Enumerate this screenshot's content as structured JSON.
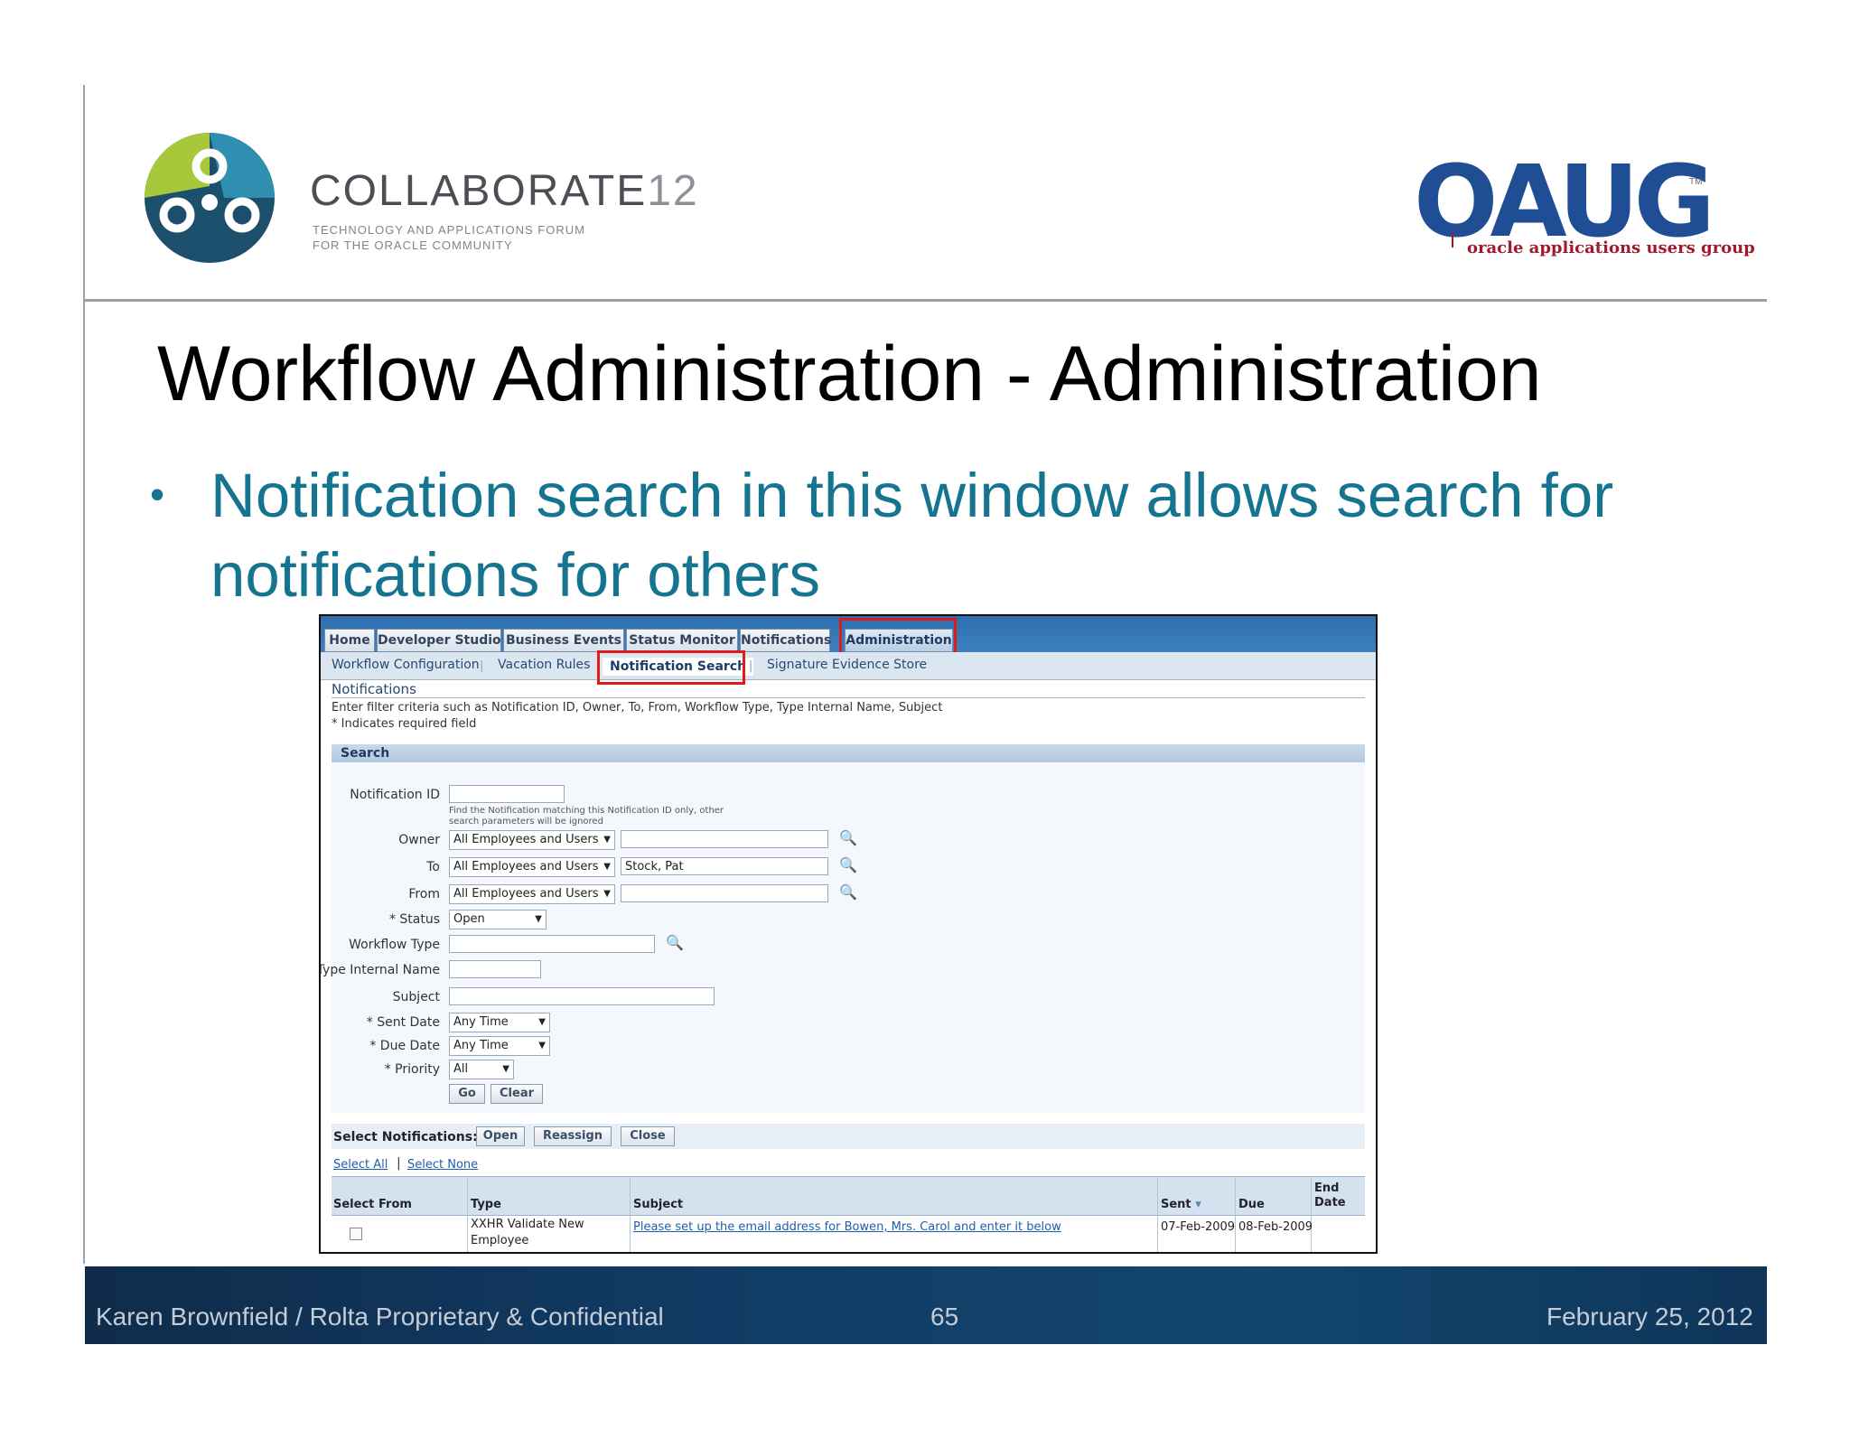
{
  "header": {
    "collab_name": "COLLABORATE",
    "collab_num": "12",
    "collab_sub1": "TECHNOLOGY AND APPLICATIONS FORUM",
    "collab_sub2": "FOR THE ORACLE COMMUNITY",
    "oaug_logo_text": "OAUG",
    "oaug_tm": "TM",
    "oaug_sub": "oracle applications users group"
  },
  "slide": {
    "title": "Workflow Administration - Administration",
    "bullet": "Notification search in this window allows search for notifications for others"
  },
  "footer": {
    "left": "Karen Brownfield  /  Rolta  Proprietary & Confidential",
    "page": "65",
    "date": "February 25, 2012"
  },
  "app": {
    "tabs": [
      "Home",
      "Developer Studio",
      "Business Events",
      "Status Monitor",
      "Notifications",
      "Administration"
    ],
    "subtabs": [
      "Workflow Configuration",
      "Vacation Rules",
      "Notification Search",
      "Signature Evidence Store"
    ],
    "section_title": "Notifications",
    "instructions": "Enter filter criteria such as Notification ID, Owner, To, From, Workflow Type, Type Internal Name, Subject",
    "required_note": "* Indicates required field",
    "search_header": "Search",
    "fields": {
      "notification_id": "Notification ID",
      "notification_hint": "Find the Notification matching this Notification ID only, other search parameters will be ignored",
      "owner": "Owner",
      "to": "To",
      "from": "From",
      "status": "* Status",
      "workflow_type": "Workflow Type",
      "type_internal_name": "Type Internal Name",
      "subject": "Subject",
      "sent_date": "* Sent Date",
      "due_date": "* Due Date",
      "priority": "* Priority"
    },
    "values": {
      "owner_select": "All Employees and Users",
      "to_select": "All Employees and Users",
      "to_value": "Stock, Pat",
      "from_select": "All Employees and Users",
      "status": "Open",
      "sent_date": "Any Time",
      "due_date": "Any Time",
      "priority": "All"
    },
    "buttons": {
      "go": "Go",
      "clear": "Clear",
      "open": "Open",
      "reassign": "Reassign",
      "close": "Close"
    },
    "select_label": "Select Notifications:",
    "select_all": "Select All",
    "select_none": "Select None",
    "columns": [
      "Select",
      "From",
      "Type",
      "Subject",
      "Sent",
      "Due",
      "End Date"
    ],
    "sort_arrow": "▾",
    "rows": [
      {
        "from": "",
        "type": "XXHR Validate New Employee",
        "subject": "Please set up the email address for Bowen, Mrs. Carol and enter it below",
        "sent": "07-Feb-2009",
        "due": "08-Feb-2009",
        "end": ""
      }
    ]
  },
  "colors": {
    "accent": "#15748f",
    "highlight": "#e01b1b",
    "footer": "#12466f"
  }
}
